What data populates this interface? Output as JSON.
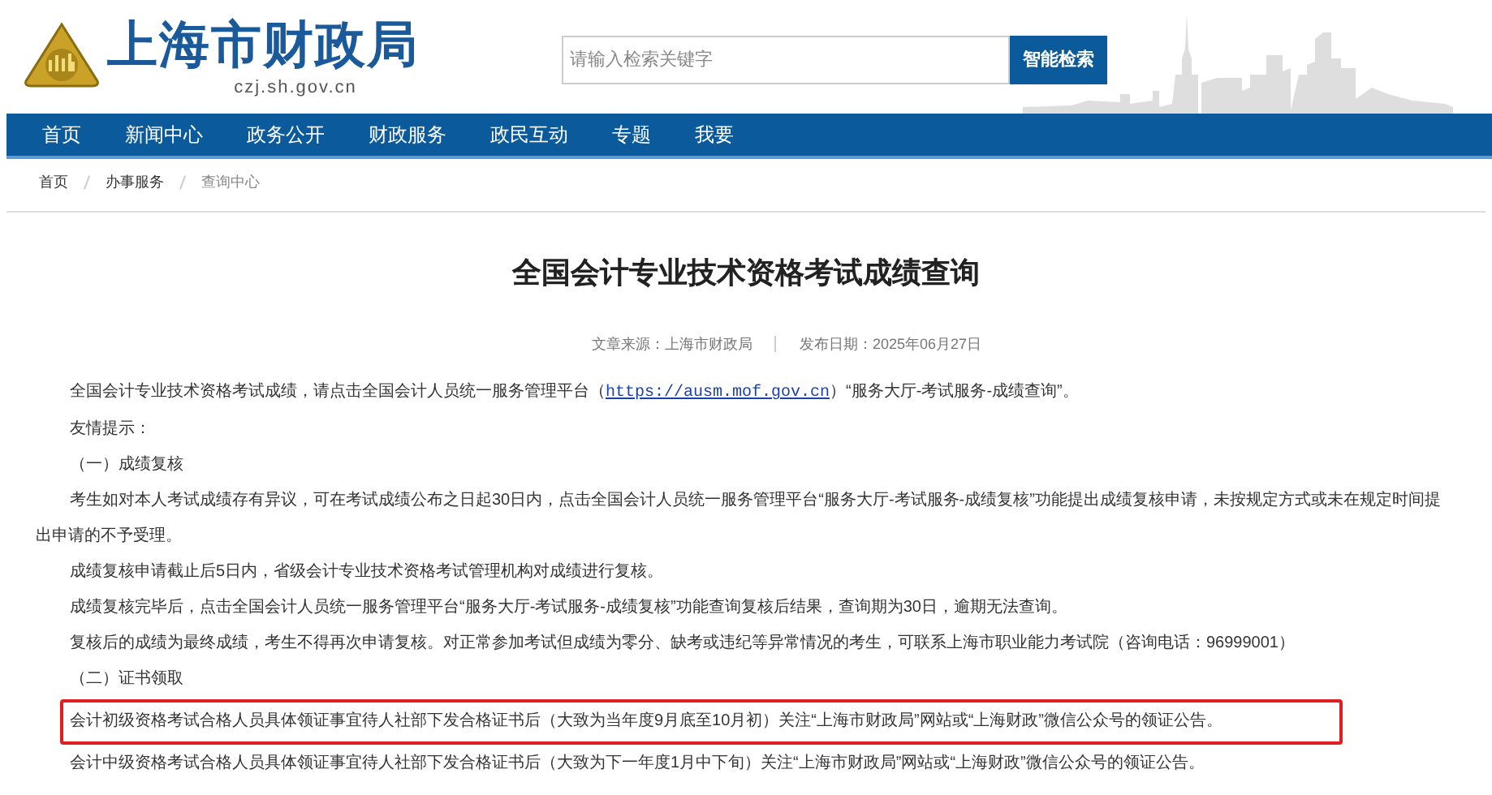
{
  "header": {
    "site_title": "上海市财政局",
    "domain": "czj.sh.gov.cn",
    "search": {
      "placeholder": "请输入检索关键字",
      "button": "智能检索"
    }
  },
  "nav": [
    "首页",
    "新闻中心",
    "政务公开",
    "财政服务",
    "政民互动",
    "专题",
    "我要"
  ],
  "breadcrumb": [
    "首页",
    "办事服务",
    "查询中心"
  ],
  "article": {
    "title": "全国会计专业技术资格考试成绩查询",
    "source": "文章来源：上海市财政局",
    "date": "发布日期：2025年06月27日",
    "paragraphs": [
      {
        "kind": "link",
        "text": "全国会计专业技术资格考试成绩，请点击全国会计人员统一服务管理平台（",
        "link": "https://ausm.mof.gov.cn",
        "after": "）“服务大厅-考试服务-成绩查询”。",
        "highlighted": false
      },
      {
        "kind": "text",
        "text": "友情提示：",
        "highlighted": false
      },
      {
        "kind": "text",
        "text": "（一）成绩复核",
        "highlighted": false
      },
      {
        "kind": "text",
        "text": "考生如对本人考试成绩存有异议，可在考试成绩公布之日起30日内，点击全国会计人员统一服务管理平台“服务大厅-考试服务-成绩复核”功能提出成绩复核申请，未按规定方式或未在规定时间提出申请的不予受理。",
        "highlighted": false
      },
      {
        "kind": "text",
        "text": "成绩复核申请截止后5日内，省级会计专业技术资格考试管理机构对成绩进行复核。",
        "highlighted": false
      },
      {
        "kind": "text",
        "text": "成绩复核完毕后，点击全国会计人员统一服务管理平台“服务大厅-考试服务-成绩复核”功能查询复核后结果，查询期为30日，逾期无法查询。",
        "highlighted": false
      },
      {
        "kind": "text",
        "text": "复核后的成绩为最终成绩，考生不得再次申请复核。对正常参加考试但成绩为零分、缺考或违纪等异常情况的考生，可联系上海市职业能力考试院（咨询电话：96999001）",
        "highlighted": false
      },
      {
        "kind": "text",
        "text": "（二）证书领取",
        "highlighted": false
      },
      {
        "kind": "text",
        "text": "会计初级资格考试合格人员具体领证事宜待人社部下发合格证书后（大致为当年度9月底至10月初）关注“上海市财政局”网站或“上海财政”微信公众号的领证公告。",
        "highlighted": true
      },
      {
        "kind": "text",
        "text": "会计中级资格考试合格人员具体领证事宜待人社部下发合格证书后（大致为下一年度1月中下旬）关注“上海市财政局”网站或“上海财政”微信公众号的领证公告。",
        "highlighted": false
      }
    ]
  }
}
